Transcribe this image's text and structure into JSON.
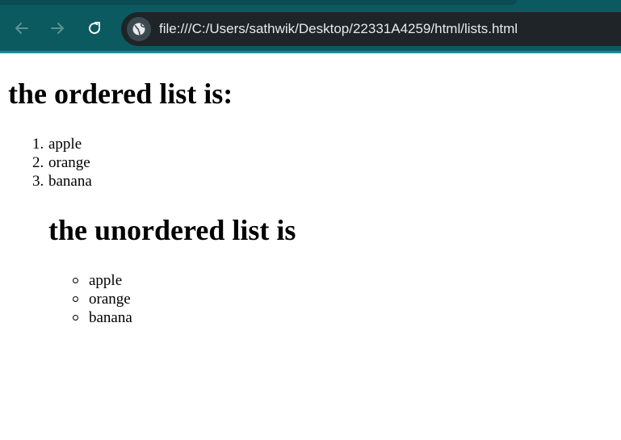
{
  "browser": {
    "url": "file:///C:/Users/sathwik/Desktop/22331A4259/html/lists.html",
    "icons": {
      "back": "arrow-left-icon",
      "forward": "arrow-right-icon",
      "reload": "reload-icon",
      "site_info": "globe-icon"
    },
    "colors": {
      "toolbar": "#0b5a60",
      "omnibox": "#1f2428",
      "url_text": "#e8eaed"
    }
  },
  "page": {
    "ordered_heading": "the ordered list is:",
    "ordered_items": [
      {
        "marker": "1.",
        "text": "apple"
      },
      {
        "marker": "2.",
        "text": "orange"
      },
      {
        "marker": "3.",
        "text": "banana"
      }
    ],
    "unordered_heading": "the unordered list is",
    "unordered_items": [
      {
        "text": "apple"
      },
      {
        "text": "orange"
      },
      {
        "text": "banana"
      }
    ]
  }
}
